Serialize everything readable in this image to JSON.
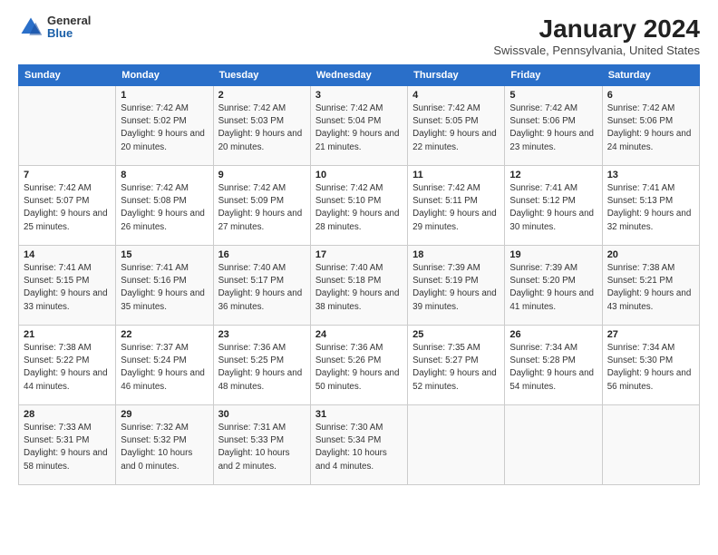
{
  "header": {
    "logo": {
      "general": "General",
      "blue": "Blue"
    },
    "title": "January 2024",
    "location": "Swissvale, Pennsylvania, United States"
  },
  "weekdays": [
    "Sunday",
    "Monday",
    "Tuesday",
    "Wednesday",
    "Thursday",
    "Friday",
    "Saturday"
  ],
  "weeks": [
    [
      {
        "day": "",
        "sunrise": "",
        "sunset": "",
        "daylight": ""
      },
      {
        "day": "1",
        "sunrise": "Sunrise: 7:42 AM",
        "sunset": "Sunset: 5:02 PM",
        "daylight": "Daylight: 9 hours and 20 minutes."
      },
      {
        "day": "2",
        "sunrise": "Sunrise: 7:42 AM",
        "sunset": "Sunset: 5:03 PM",
        "daylight": "Daylight: 9 hours and 20 minutes."
      },
      {
        "day": "3",
        "sunrise": "Sunrise: 7:42 AM",
        "sunset": "Sunset: 5:04 PM",
        "daylight": "Daylight: 9 hours and 21 minutes."
      },
      {
        "day": "4",
        "sunrise": "Sunrise: 7:42 AM",
        "sunset": "Sunset: 5:05 PM",
        "daylight": "Daylight: 9 hours and 22 minutes."
      },
      {
        "day": "5",
        "sunrise": "Sunrise: 7:42 AM",
        "sunset": "Sunset: 5:06 PM",
        "daylight": "Daylight: 9 hours and 23 minutes."
      },
      {
        "day": "6",
        "sunrise": "Sunrise: 7:42 AM",
        "sunset": "Sunset: 5:06 PM",
        "daylight": "Daylight: 9 hours and 24 minutes."
      }
    ],
    [
      {
        "day": "7",
        "sunrise": "Sunrise: 7:42 AM",
        "sunset": "Sunset: 5:07 PM",
        "daylight": "Daylight: 9 hours and 25 minutes."
      },
      {
        "day": "8",
        "sunrise": "Sunrise: 7:42 AM",
        "sunset": "Sunset: 5:08 PM",
        "daylight": "Daylight: 9 hours and 26 minutes."
      },
      {
        "day": "9",
        "sunrise": "Sunrise: 7:42 AM",
        "sunset": "Sunset: 5:09 PM",
        "daylight": "Daylight: 9 hours and 27 minutes."
      },
      {
        "day": "10",
        "sunrise": "Sunrise: 7:42 AM",
        "sunset": "Sunset: 5:10 PM",
        "daylight": "Daylight: 9 hours and 28 minutes."
      },
      {
        "day": "11",
        "sunrise": "Sunrise: 7:42 AM",
        "sunset": "Sunset: 5:11 PM",
        "daylight": "Daylight: 9 hours and 29 minutes."
      },
      {
        "day": "12",
        "sunrise": "Sunrise: 7:41 AM",
        "sunset": "Sunset: 5:12 PM",
        "daylight": "Daylight: 9 hours and 30 minutes."
      },
      {
        "day": "13",
        "sunrise": "Sunrise: 7:41 AM",
        "sunset": "Sunset: 5:13 PM",
        "daylight": "Daylight: 9 hours and 32 minutes."
      }
    ],
    [
      {
        "day": "14",
        "sunrise": "Sunrise: 7:41 AM",
        "sunset": "Sunset: 5:15 PM",
        "daylight": "Daylight: 9 hours and 33 minutes."
      },
      {
        "day": "15",
        "sunrise": "Sunrise: 7:41 AM",
        "sunset": "Sunset: 5:16 PM",
        "daylight": "Daylight: 9 hours and 35 minutes."
      },
      {
        "day": "16",
        "sunrise": "Sunrise: 7:40 AM",
        "sunset": "Sunset: 5:17 PM",
        "daylight": "Daylight: 9 hours and 36 minutes."
      },
      {
        "day": "17",
        "sunrise": "Sunrise: 7:40 AM",
        "sunset": "Sunset: 5:18 PM",
        "daylight": "Daylight: 9 hours and 38 minutes."
      },
      {
        "day": "18",
        "sunrise": "Sunrise: 7:39 AM",
        "sunset": "Sunset: 5:19 PM",
        "daylight": "Daylight: 9 hours and 39 minutes."
      },
      {
        "day": "19",
        "sunrise": "Sunrise: 7:39 AM",
        "sunset": "Sunset: 5:20 PM",
        "daylight": "Daylight: 9 hours and 41 minutes."
      },
      {
        "day": "20",
        "sunrise": "Sunrise: 7:38 AM",
        "sunset": "Sunset: 5:21 PM",
        "daylight": "Daylight: 9 hours and 43 minutes."
      }
    ],
    [
      {
        "day": "21",
        "sunrise": "Sunrise: 7:38 AM",
        "sunset": "Sunset: 5:22 PM",
        "daylight": "Daylight: 9 hours and 44 minutes."
      },
      {
        "day": "22",
        "sunrise": "Sunrise: 7:37 AM",
        "sunset": "Sunset: 5:24 PM",
        "daylight": "Daylight: 9 hours and 46 minutes."
      },
      {
        "day": "23",
        "sunrise": "Sunrise: 7:36 AM",
        "sunset": "Sunset: 5:25 PM",
        "daylight": "Daylight: 9 hours and 48 minutes."
      },
      {
        "day": "24",
        "sunrise": "Sunrise: 7:36 AM",
        "sunset": "Sunset: 5:26 PM",
        "daylight": "Daylight: 9 hours and 50 minutes."
      },
      {
        "day": "25",
        "sunrise": "Sunrise: 7:35 AM",
        "sunset": "Sunset: 5:27 PM",
        "daylight": "Daylight: 9 hours and 52 minutes."
      },
      {
        "day": "26",
        "sunrise": "Sunrise: 7:34 AM",
        "sunset": "Sunset: 5:28 PM",
        "daylight": "Daylight: 9 hours and 54 minutes."
      },
      {
        "day": "27",
        "sunrise": "Sunrise: 7:34 AM",
        "sunset": "Sunset: 5:30 PM",
        "daylight": "Daylight: 9 hours and 56 minutes."
      }
    ],
    [
      {
        "day": "28",
        "sunrise": "Sunrise: 7:33 AM",
        "sunset": "Sunset: 5:31 PM",
        "daylight": "Daylight: 9 hours and 58 minutes."
      },
      {
        "day": "29",
        "sunrise": "Sunrise: 7:32 AM",
        "sunset": "Sunset: 5:32 PM",
        "daylight": "Daylight: 10 hours and 0 minutes."
      },
      {
        "day": "30",
        "sunrise": "Sunrise: 7:31 AM",
        "sunset": "Sunset: 5:33 PM",
        "daylight": "Daylight: 10 hours and 2 minutes."
      },
      {
        "day": "31",
        "sunrise": "Sunrise: 7:30 AM",
        "sunset": "Sunset: 5:34 PM",
        "daylight": "Daylight: 10 hours and 4 minutes."
      },
      {
        "day": "",
        "sunrise": "",
        "sunset": "",
        "daylight": ""
      },
      {
        "day": "",
        "sunrise": "",
        "sunset": "",
        "daylight": ""
      },
      {
        "day": "",
        "sunrise": "",
        "sunset": "",
        "daylight": ""
      }
    ]
  ]
}
